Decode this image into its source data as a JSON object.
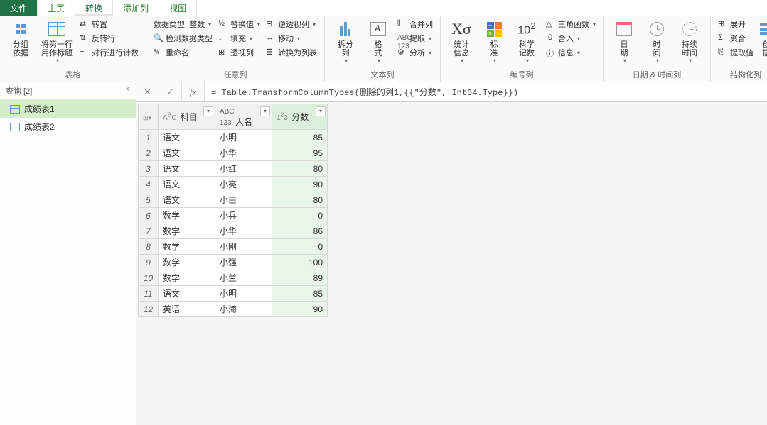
{
  "tabs": {
    "file": "文件",
    "home": "主页",
    "transform": "转换",
    "addcol": "添加列",
    "view": "视图"
  },
  "ribbon": {
    "group_table": {
      "label": "表格",
      "groupby": "分组\n依据",
      "firstrowheader": "将第一行\n用作标题",
      "transpose": "转置",
      "reverse": "反转行",
      "countrows": "对行进行计数"
    },
    "group_anycol": {
      "label": "任意列",
      "datatype": "数据类型: 整数",
      "detecttype": "检测数据类型",
      "rename": "重命名",
      "replace": "替换值",
      "fill": "填充",
      "pivot": "透视列",
      "unpivot": "逆透视列",
      "move": "移动",
      "tolist": "转换为列表"
    },
    "group_textcol": {
      "label": "文本列",
      "split": "拆分\n列",
      "format": "格\n式",
      "merge": "合并列",
      "extract": "提取",
      "parse": "分析"
    },
    "group_numcol": {
      "label": "编号列",
      "stats": "统计\n信息",
      "standard": "标\n准",
      "scientific": "科学\n记数",
      "trig": "三角函数",
      "rounding": "舍入",
      "info": "信息"
    },
    "group_datetime": {
      "label": "日期 & 时间列",
      "date": "日\n期",
      "time": "时\n间",
      "duration": "持续\n时间"
    },
    "group_struct": {
      "label": "结构化列",
      "expand": "展开",
      "aggregate": "聚合",
      "extractval": "提取值",
      "create": "创\n据"
    }
  },
  "sidebar": {
    "header": "查询 [2]",
    "items": [
      "成绩表1",
      "成绩表2"
    ]
  },
  "formula": "= Table.TransformColumnTypes(删除的列1,{{\"分数\", Int64.Type}})",
  "table": {
    "columns": [
      {
        "type": "ABC",
        "name": "科目"
      },
      {
        "type": "ABC123",
        "name": "人名"
      },
      {
        "type": "123",
        "name": "分数"
      }
    ],
    "rows": [
      [
        "语文",
        "小明",
        85
      ],
      [
        "语文",
        "小华",
        95
      ],
      [
        "语文",
        "小红",
        80
      ],
      [
        "语文",
        "小亮",
        90
      ],
      [
        "语文",
        "小白",
        80
      ],
      [
        "数学",
        "小兵",
        0
      ],
      [
        "数学",
        "小华",
        86
      ],
      [
        "数学",
        "小刚",
        0
      ],
      [
        "数学",
        "小强",
        100
      ],
      [
        "数学",
        "小兰",
        89
      ],
      [
        "语文",
        "小明",
        85
      ],
      [
        "英语",
        "小海",
        90
      ]
    ]
  }
}
